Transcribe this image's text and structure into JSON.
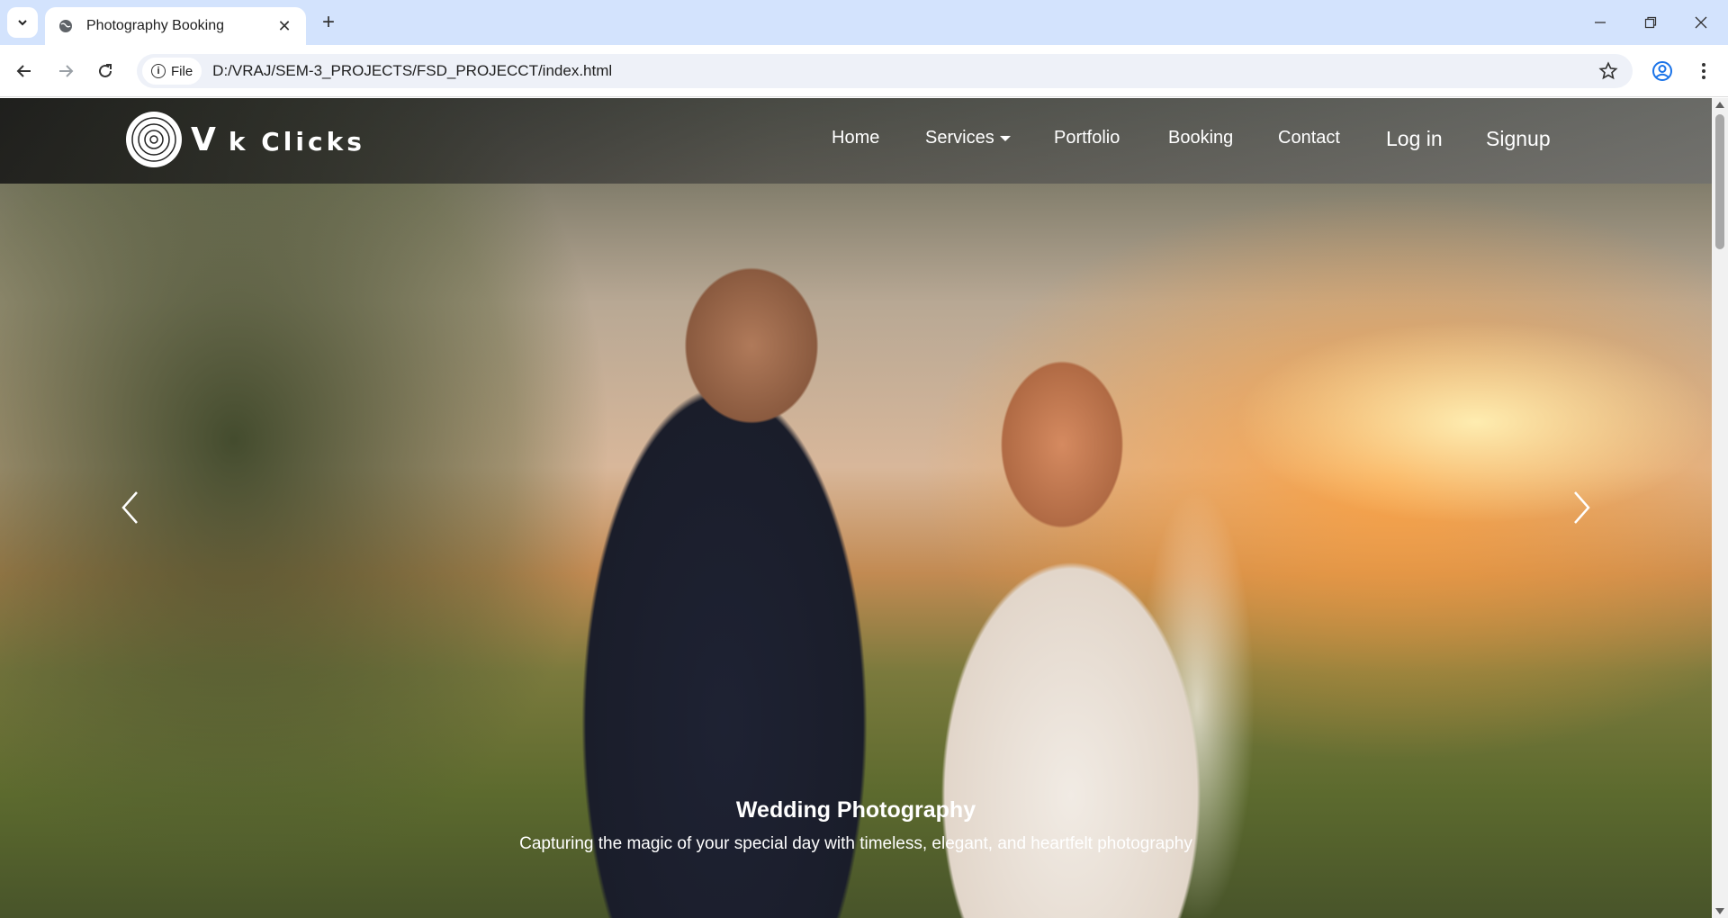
{
  "browser": {
    "tab_title": "Photography Booking",
    "address_chip": "File",
    "url": "D:/VRAJ/SEM-3_PROJECTS/FSD_PROJECCT/index.html",
    "icons": [
      "tab-search-icon",
      "globe-icon",
      "close-icon",
      "plus-icon",
      "minimize-icon",
      "restore-icon",
      "window-close-icon",
      "back-icon",
      "forward-icon",
      "reload-icon",
      "info-icon",
      "star-icon",
      "profile-icon",
      "kebab-menu-icon"
    ]
  },
  "site": {
    "logo": {
      "letter": "V",
      "rest": "k Clicks"
    },
    "nav": {
      "home": "Home",
      "services": "Services",
      "portfolio": "Portfolio",
      "booking": "Booking",
      "contact": "Contact",
      "login": "Log in",
      "signup": "Signup"
    },
    "carousel": {
      "title": "Wedding Photography",
      "subtitle": "Capturing the magic of your special day with timeless, elegant, and heartfelt photography"
    }
  }
}
